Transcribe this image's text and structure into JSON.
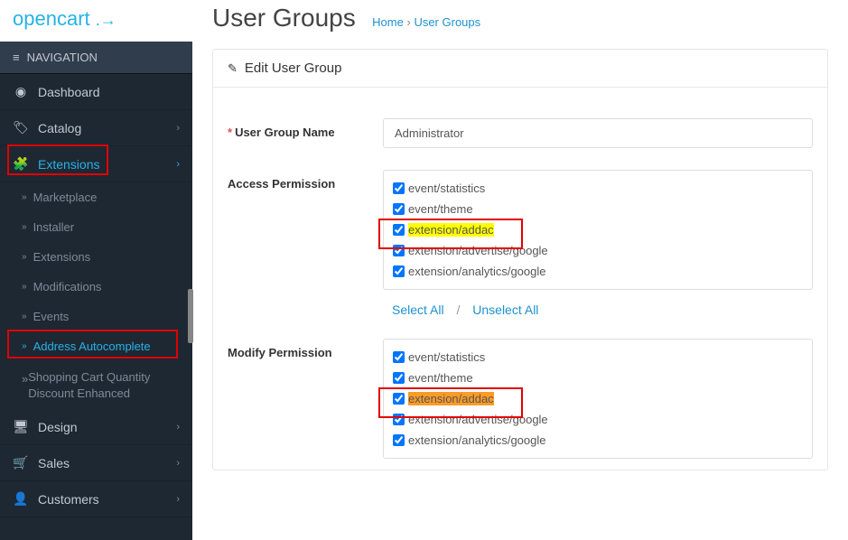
{
  "logo": {
    "open": "open",
    "cart": "cart"
  },
  "nav_header": "NAVIGATION",
  "sidebar": {
    "dashboard": "Dashboard",
    "catalog": "Catalog",
    "extensions": "Extensions",
    "marketplace": "Marketplace",
    "installer": "Installer",
    "extensions_sub": "Extensions",
    "modifications": "Modifications",
    "events": "Events",
    "address_auto": "Address Autocomplete",
    "shopping_cart": "Shopping Cart Quantity Discount Enhanced",
    "design": "Design",
    "sales": "Sales",
    "customers": "Customers"
  },
  "page": {
    "title": "User Groups",
    "breadcrumb_home": "Home",
    "breadcrumb_current": "User Groups"
  },
  "panel_title": "Edit User Group",
  "form": {
    "name_label": "User Group Name",
    "name_value": "Administrator",
    "access_label": "Access Permission",
    "modify_label": "Modify Permission",
    "select_all": "Select All",
    "unselect_all": "Unselect All"
  },
  "perms": {
    "p0": "event/statistics",
    "p1": "event/theme",
    "p2": "extension/addac",
    "p3": "extension/advertise/google",
    "p4": "extension/analytics/google"
  }
}
